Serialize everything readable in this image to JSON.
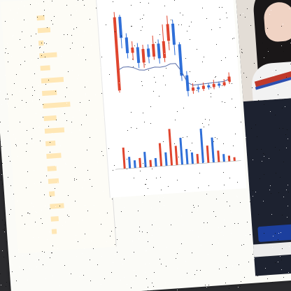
{
  "orderbook": {
    "title": "",
    "rows": [
      {
        "label": "",
        "price": "",
        "vol": "",
        "bar": 0.15
      },
      {
        "label": "",
        "price": "",
        "vol": "",
        "bar": 0.25
      },
      {
        "label": "",
        "price": "",
        "vol": "",
        "bar": 0.1
      },
      {
        "label": "",
        "price": "",
        "vol": "",
        "bar": 0.35
      },
      {
        "label": "",
        "price": "",
        "vol": "",
        "bar": 0.2
      },
      {
        "label": "",
        "price": "",
        "vol": "",
        "bar": 0.45
      },
      {
        "label": "",
        "price": "",
        "vol": "",
        "bar": 0.3
      },
      {
        "label": "",
        "price": "",
        "vol": "",
        "bar": 0.55
      },
      {
        "label": "",
        "price": "",
        "vol": "",
        "bar": 0.25
      },
      {
        "label": "",
        "price": "",
        "vol": "",
        "bar": 0.4
      },
      {
        "label": "",
        "price": "",
        "vol": "",
        "bar": 0.2
      },
      {
        "label": "",
        "price": "",
        "vol": "",
        "bar": 0.3
      },
      {
        "label": "",
        "price": "",
        "vol": "",
        "bar": 0.18
      },
      {
        "label": "",
        "price": "",
        "vol": "",
        "bar": 0.22
      },
      {
        "label": "",
        "price": "",
        "vol": "",
        "bar": 0.12
      },
      {
        "label": "",
        "price": "",
        "vol": "",
        "bar": 0.28
      },
      {
        "label": "",
        "price": "",
        "vol": "",
        "bar": 0.16
      },
      {
        "label": "",
        "price": "",
        "vol": "",
        "bar": 0.1
      }
    ]
  },
  "chart_data": {
    "type": "candlestick+volume",
    "candles": [
      {
        "o": 0.2,
        "c": 0.9,
        "h": 0.95,
        "l": 0.18,
        "up": true
      },
      {
        "o": 0.9,
        "c": 0.7,
        "h": 0.92,
        "l": 0.6,
        "up": false
      },
      {
        "o": 0.7,
        "c": 0.55,
        "h": 0.74,
        "l": 0.5,
        "up": false
      },
      {
        "o": 0.55,
        "c": 0.6,
        "h": 0.66,
        "l": 0.48,
        "up": true
      },
      {
        "o": 0.6,
        "c": 0.45,
        "h": 0.64,
        "l": 0.4,
        "up": false
      },
      {
        "o": 0.45,
        "c": 0.58,
        "h": 0.62,
        "l": 0.4,
        "up": true
      },
      {
        "o": 0.58,
        "c": 0.5,
        "h": 0.62,
        "l": 0.44,
        "up": false
      },
      {
        "o": 0.5,
        "c": 0.62,
        "h": 0.7,
        "l": 0.47,
        "up": true
      },
      {
        "o": 0.62,
        "c": 0.48,
        "h": 0.66,
        "l": 0.43,
        "up": false
      },
      {
        "o": 0.48,
        "c": 0.64,
        "h": 0.8,
        "l": 0.44,
        "up": true
      },
      {
        "o": 0.64,
        "c": 0.8,
        "h": 0.88,
        "l": 0.55,
        "up": true
      },
      {
        "o": 0.8,
        "c": 0.6,
        "h": 0.84,
        "l": 0.5,
        "up": false
      },
      {
        "o": 0.6,
        "c": 0.3,
        "h": 0.62,
        "l": 0.25,
        "up": false
      },
      {
        "o": 0.3,
        "c": 0.15,
        "h": 0.34,
        "l": 0.1,
        "up": false
      },
      {
        "o": 0.15,
        "c": 0.18,
        "h": 0.22,
        "l": 0.12,
        "up": true
      },
      {
        "o": 0.18,
        "c": 0.16,
        "h": 0.2,
        "l": 0.13,
        "up": false
      },
      {
        "o": 0.16,
        "c": 0.19,
        "h": 0.22,
        "l": 0.14,
        "up": true
      },
      {
        "o": 0.19,
        "c": 0.17,
        "h": 0.21,
        "l": 0.15,
        "up": false
      },
      {
        "o": 0.17,
        "c": 0.2,
        "h": 0.24,
        "l": 0.15,
        "up": true
      },
      {
        "o": 0.2,
        "c": 0.18,
        "h": 0.22,
        "l": 0.16,
        "up": false
      },
      {
        "o": 0.18,
        "c": 0.21,
        "h": 0.24,
        "l": 0.17,
        "up": true
      },
      {
        "o": 0.21,
        "c": 0.26,
        "h": 0.3,
        "l": 0.19,
        "up": true
      }
    ],
    "volume": [
      0.55,
      0.3,
      0.2,
      0.25,
      0.4,
      0.18,
      0.22,
      0.6,
      0.35,
      0.95,
      0.5,
      0.7,
      0.4,
      0.3,
      0.25,
      0.9,
      0.45,
      0.65,
      0.3,
      0.2,
      0.15,
      0.1
    ]
  },
  "notes": [
    "",
    "",
    ""
  ],
  "tabs": [
    "",
    "",
    ""
  ],
  "stream": {
    "chat": [
      {
        "text": "",
        "color": "#ffffff"
      },
      {
        "text": "",
        "color": "#ffd25a"
      },
      {
        "text": "",
        "color": "#ff5959"
      },
      {
        "text": "",
        "color": "#ffffff"
      },
      {
        "text": "",
        "color": "#ff5959"
      },
      {
        "text": "",
        "color": "#ffffff"
      },
      {
        "text": "",
        "color": "#ffd25a"
      },
      {
        "text": "",
        "color": "#ffffff"
      },
      {
        "text": "",
        "color": "#ff5959"
      }
    ],
    "banner": ""
  },
  "colors": {
    "up": "#e0452e",
    "down": "#2f6fd8",
    "avg": "#5a6ea8"
  }
}
